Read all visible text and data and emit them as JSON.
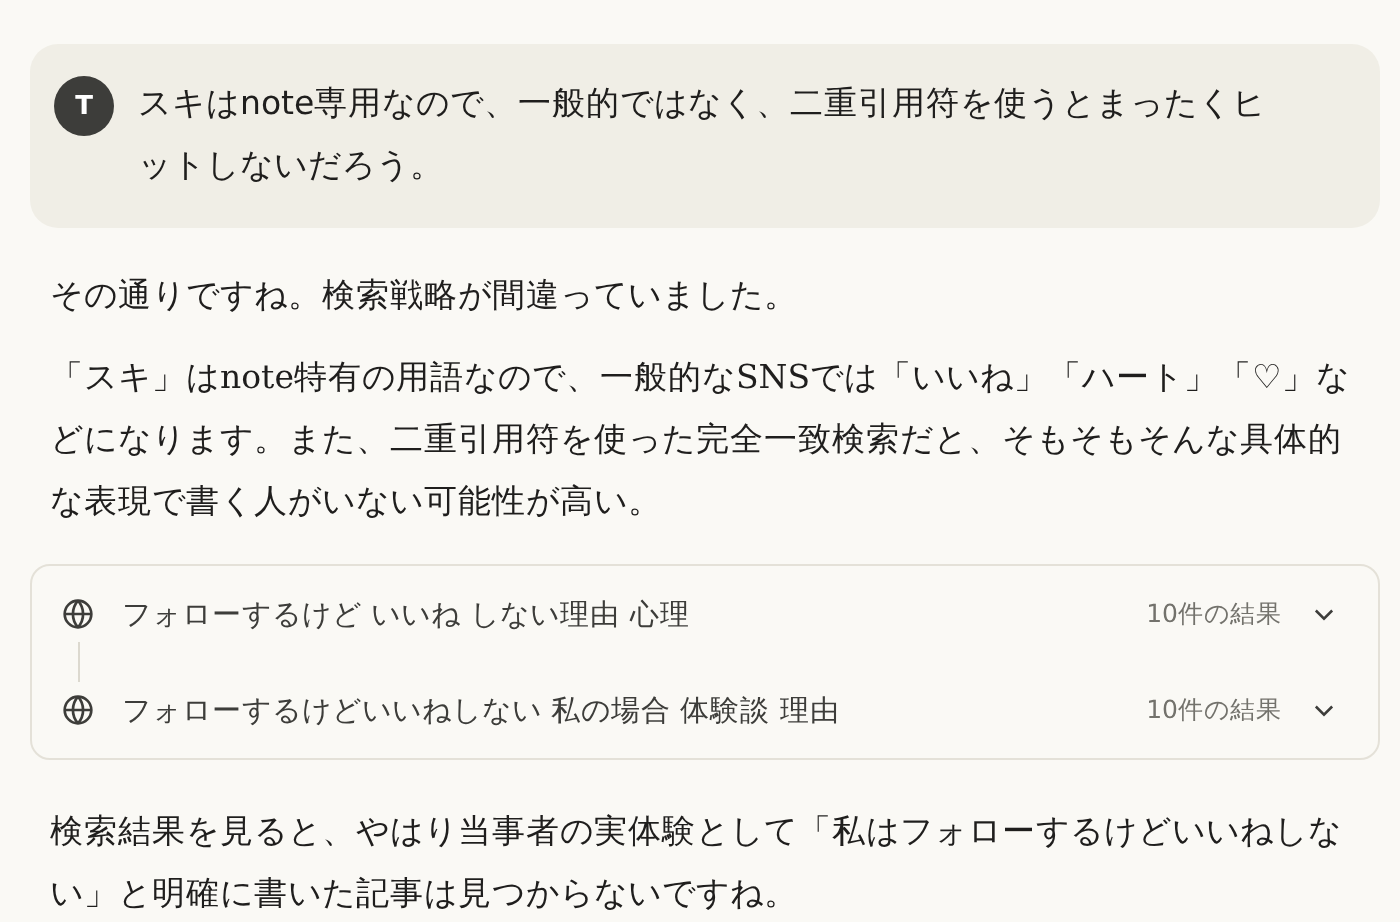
{
  "user_message": {
    "avatar": "T",
    "text": "スキはnote専用なので、一般的ではなく、二重引用符を使うとまったくヒットしないだろう。"
  },
  "assistant_intro": [
    "その通りですね。検索戦略が間違っていました。",
    "「スキ」はnote特有の用語なので、一般的なSNSでは「いいね」「ハート」「♡」などになります。また、二重引用符を使った完全一致検索だと、そもそもそんな具体的な表現で書く人がいない可能性が高い。"
  ],
  "searches": [
    {
      "query": "フォローするけど いいね しない理由 心理",
      "results": "10件の結果",
      "expanded": false
    },
    {
      "query": "フォローするけどいいねしない 私の場合 体験談 理由",
      "results": "10件の結果",
      "expanded": false
    }
  ],
  "assistant_followup": [
    "検索結果を見ると、やはり当事者の実体験として「私はフォローするけどいいねしない」と明確に書いた記事は見つからないですね。"
  ]
}
